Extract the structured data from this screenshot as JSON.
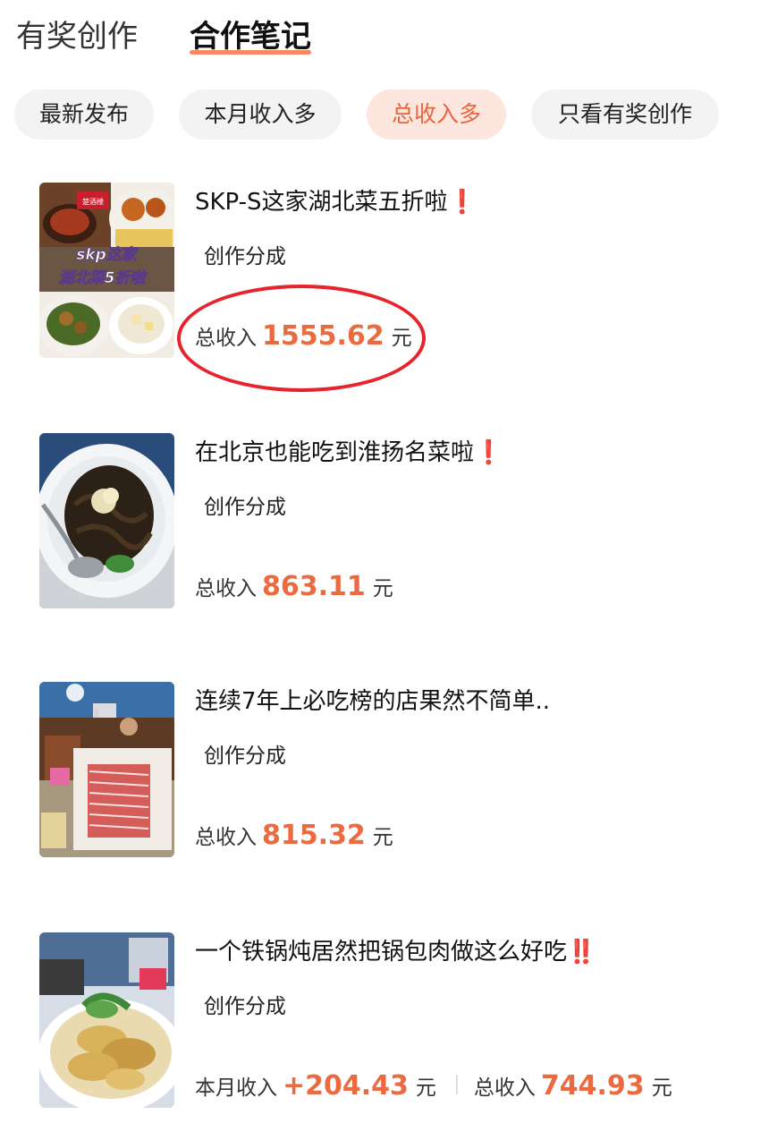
{
  "top_tabs": [
    {
      "label": "有奖创作"
    },
    {
      "label": "合作笔记"
    }
  ],
  "filters": [
    {
      "label": "最新发布"
    },
    {
      "label": "本月收入多"
    },
    {
      "label": "总收入多"
    },
    {
      "label": "只看有奖创作"
    }
  ],
  "colors": {
    "accent": "#ec6a3f",
    "chip_active_bg": "#fde6dd",
    "chip_bg": "#f3f3f3",
    "circle": "#e8232c",
    "exclamation": "#e23a2f"
  },
  "notes": [
    {
      "title": "SKP-S这家湖北菜五折啦",
      "mark": "❗",
      "tag": "创作分成",
      "total_label": "总收入",
      "total_amount": "1555.62",
      "unit": "元",
      "thumb_text_1": "skp这家",
      "thumb_text_2": "湖北菜5折啦",
      "thumb_logo": "楚酒楼"
    },
    {
      "title": "在北京也能吃到淮扬名菜啦",
      "mark": "❗",
      "tag": "创作分成",
      "total_label": "总收入",
      "total_amount": "863.11",
      "unit": "元"
    },
    {
      "title": "连续7年上必吃榜的店果然不简单..",
      "mark": "",
      "tag": "创作分成",
      "total_label": "总收入",
      "total_amount": "815.32",
      "unit": "元"
    },
    {
      "title": "一个铁锅炖居然把锅包肉做这么好吃",
      "mark": "‼️",
      "tag": "创作分成",
      "month_label": "本月收入",
      "month_amount": "+204.43",
      "total_label": "总收入",
      "total_amount": "744.93",
      "unit": "元"
    }
  ]
}
